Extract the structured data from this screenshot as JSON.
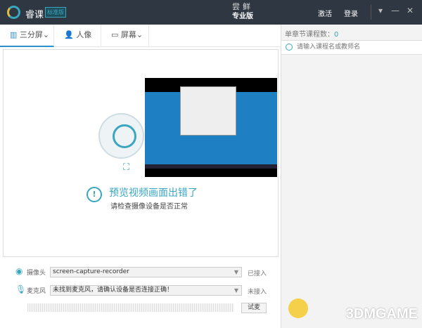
{
  "titlebar": {
    "app_name": "睿课",
    "edition": "标准版",
    "promo_line1": "尝鲜",
    "promo_line2": "专业版",
    "activate": "激活",
    "login": "登录",
    "menu": "▾",
    "minimize": "—",
    "close": "✕"
  },
  "tabs": [
    {
      "label": "三分屏",
      "icon": "layout-icon",
      "arrow": "⌄"
    },
    {
      "label": "人像",
      "icon": "person-icon"
    },
    {
      "label": "屏幕",
      "icon": "monitor-icon",
      "arrow": "⌄"
    }
  ],
  "preview": {
    "error_title": "预览视频画面出错了",
    "error_sub": "请检查摄像设备是否正常",
    "error_icon": "!"
  },
  "devices": {
    "camera": {
      "label": "摄像头",
      "value": "screen-capture-recorder",
      "status": "已接入"
    },
    "mic": {
      "label": "麦克风",
      "value": "未找到麦克风，请确认设备是否连接正确！",
      "status": "未接入"
    },
    "test_label": "试麦"
  },
  "right": {
    "count_label": "单章节课程数：",
    "count": "0",
    "search_placeholder": "请输入课程名或教师名"
  },
  "watermark": "3DMGAME"
}
